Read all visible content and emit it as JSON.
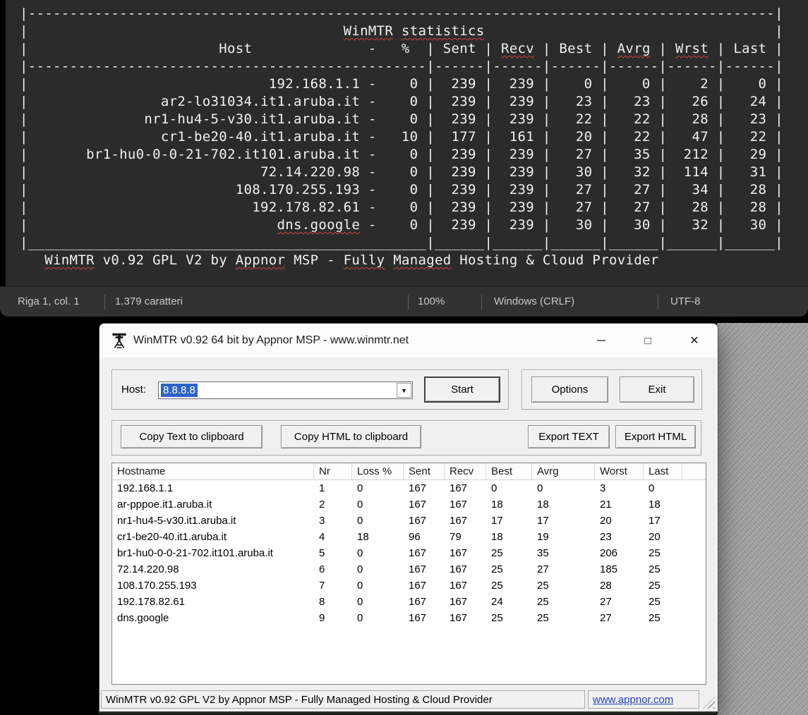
{
  "notepad": {
    "lines": [
      "|------------------------------------------------------------------------------------------|",
      "|                                      WinMTR statistics                                   |",
      "|                       Host              -   %  | Sent | Recv | Best | Avrg | Wrst | Last |",
      "|------------------------------------------------|------|------|------|------|------|------|",
      "|                             192.168.1.1 -    0 |  239 |  239 |    0 |    0 |    2 |    0 |",
      "|                ar2-lo31034.it1.aruba.it -    0 |  239 |  239 |   23 |   23 |   26 |   24 |",
      "|              nr1-hu4-5-v30.it1.aruba.it -    0 |  239 |  239 |   22 |   22 |   28 |   23 |",
      "|                cr1-be20-40.it1.aruba.it -   10 |  177 |  161 |   20 |   22 |   47 |   22 |",
      "|       br1-hu0-0-0-21-702.it101.aruba.it -    0 |  239 |  239 |   27 |   35 |  212 |   29 |",
      "|                            72.14.220.98 -    0 |  239 |  239 |   30 |   32 |  114 |   31 |",
      "|                         108.170.255.193 -    0 |  239 |  239 |   27 |   27 |   34 |   28 |",
      "|                           192.178.82.61 -    0 |  239 |  239 |   27 |   27 |   28 |   28 |",
      "|                              dns.google -    0 |  239 |  239 |   30 |   30 |   32 |   30 |",
      "|________________________________________________|______|______|______|______|______|______|",
      "   WinMTR v0.92 GPL V2 by Appnor MSP - Fully Managed Hosting & Cloud Provider"
    ],
    "misspelled": [
      "WinMTR",
      "statistics",
      "Recv",
      "Avrg",
      "Wrst",
      "dns.google",
      "Appnor",
      "Fully",
      "Managed"
    ],
    "statusbar": {
      "position": "Riga 1, col. 1",
      "characters": "1.379 caratteri",
      "zoom": "100%",
      "line_ending": "Windows (CRLF)",
      "encoding": "UTF-8"
    }
  },
  "winmtr": {
    "titlebar": {
      "title": "WinMTR v0.92 64 bit by Appnor MSP - www.winmtr.net"
    },
    "host_section": {
      "label": "Host:",
      "value": "8.8.8.8",
      "start": "Start",
      "options": "Options",
      "exit": "Exit"
    },
    "clipboard_section": {
      "copy_text": "Copy Text to clipboard",
      "copy_html": "Copy HTML to clipboard",
      "export_text": "Export TEXT",
      "export_html": "Export HTML"
    },
    "table": {
      "columns": [
        "Hostname",
        "Nr",
        "Loss %",
        "Sent",
        "Recv",
        "Best",
        "Avrg",
        "Worst",
        "Last"
      ],
      "rows": [
        [
          "192.168.1.1",
          "1",
          "0",
          "167",
          "167",
          "0",
          "0",
          "3",
          "0"
        ],
        [
          "ar-pppoe.it1.aruba.it",
          "2",
          "0",
          "167",
          "167",
          "18",
          "18",
          "21",
          "18"
        ],
        [
          "nr1-hu4-5-v30.it1.aruba.it",
          "3",
          "0",
          "167",
          "167",
          "17",
          "17",
          "20",
          "17"
        ],
        [
          "cr1-be20-40.it1.aruba.it",
          "4",
          "18",
          "96",
          "79",
          "18",
          "19",
          "23",
          "20"
        ],
        [
          "br1-hu0-0-0-21-702.it101.aruba.it",
          "5",
          "0",
          "167",
          "167",
          "25",
          "35",
          "206",
          "25"
        ],
        [
          "72.14.220.98",
          "6",
          "0",
          "167",
          "167",
          "25",
          "27",
          "185",
          "25"
        ],
        [
          "108.170.255.193",
          "7",
          "0",
          "167",
          "167",
          "25",
          "25",
          "28",
          "25"
        ],
        [
          "192.178.82.61",
          "8",
          "0",
          "167",
          "167",
          "24",
          "25",
          "27",
          "25"
        ],
        [
          "dns.google",
          "9",
          "0",
          "167",
          "167",
          "25",
          "25",
          "27",
          "25"
        ]
      ]
    },
    "statusbar": {
      "text": "WinMTR v0.92 GPL V2 by Appnor MSP - Fully Managed Hosting & Cloud Provider",
      "link": "www.appnor.com"
    }
  },
  "icons": {
    "minimize": "─",
    "maximize": "□",
    "close": "✕",
    "dropdown": "▼"
  },
  "colors": {
    "editor_background": "#2b2b2b",
    "selection_blue": "#2e63c6",
    "link_blue": "#1f3fbf",
    "squiggle_red": "#cf4545"
  }
}
